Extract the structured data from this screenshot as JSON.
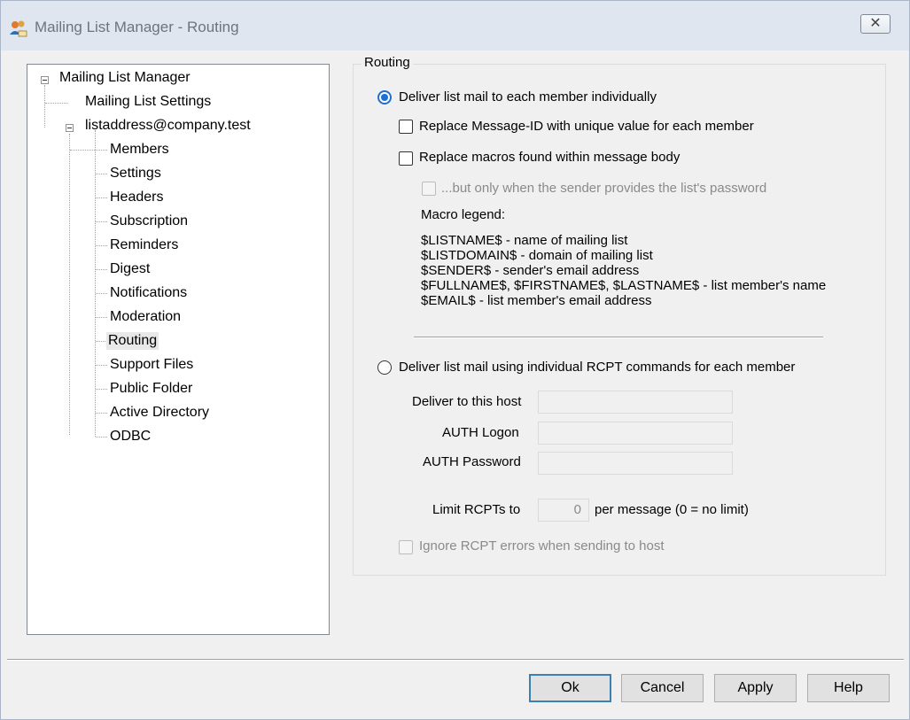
{
  "window": {
    "title": "Mailing List Manager - Routing",
    "close_glyph": "✕"
  },
  "tree": {
    "root": "Mailing List Manager",
    "settings": "Mailing List Settings",
    "list": "listaddress@company.test",
    "children": [
      "Members",
      "Settings",
      "Headers",
      "Subscription",
      "Reminders",
      "Digest",
      "Notifications",
      "Moderation",
      "Routing",
      "Support Files",
      "Public Folder",
      "Active Directory",
      "ODBC"
    ],
    "selected": "Routing"
  },
  "routing": {
    "group_label": "Routing",
    "option1": "Deliver list mail to each member individually",
    "option1_selected": true,
    "replace_msgid": "Replace Message-ID with unique value for each member",
    "replace_macros": "Replace macros found within message body",
    "only_password": "...but only when the sender provides the list's password",
    "macro_legend_label": "Macro legend:",
    "macros": [
      "$LISTNAME$ - name of mailing list",
      "$LISTDOMAIN$ - domain of mailing list",
      "$SENDER$ - sender's email address",
      "$FULLNAME$, $FIRSTNAME$, $LASTNAME$ - list member's name",
      "$EMAIL$ - list member's email  address"
    ],
    "option2": "Deliver list mail using individual RCPT commands for each member",
    "host_label": "Deliver to this host",
    "host_value": "",
    "logon_label": "AUTH Logon",
    "logon_value": "",
    "password_label": "AUTH Password",
    "password_value": "",
    "limit_label": "Limit RCPTs to",
    "limit_value": "0",
    "limit_suffix": "per message (0 = no limit)",
    "ignore_errors": "Ignore RCPT errors when sending to host"
  },
  "buttons": {
    "ok": "Ok",
    "cancel": "Cancel",
    "apply": "Apply",
    "help": "Help"
  },
  "colors": {
    "accent": "#1e6fd0",
    "titlebar": "#dfe6ef"
  }
}
